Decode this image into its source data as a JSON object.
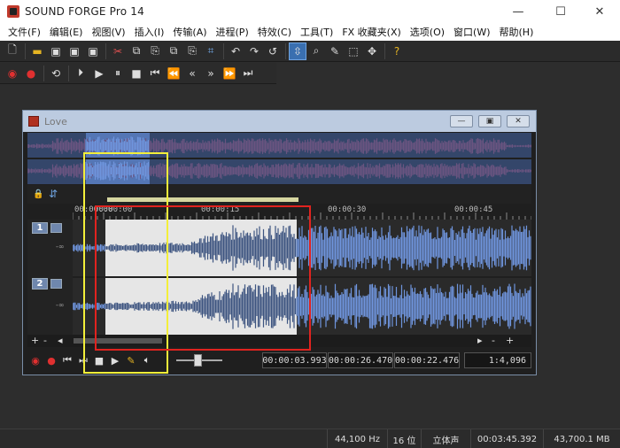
{
  "app": {
    "title": "SOUND FORGE Pro 14"
  },
  "window_controls": {
    "minimize": "—",
    "maximize": "☐",
    "close": "✕"
  },
  "menu": [
    "文件(F)",
    "编辑(E)",
    "视图(V)",
    "插入(I)",
    "传输(A)",
    "进程(P)",
    "特效(C)",
    "工具(T)",
    "FX 收藏夹(X)",
    "选项(O)",
    "窗口(W)",
    "帮助(H)"
  ],
  "data_window": {
    "title": "Love",
    "controls": {
      "minimize": "—",
      "restore": "▣",
      "close": "✕"
    },
    "ruler": [
      "00:00:00",
      "00:00:15",
      "00:00:30",
      "00:00:45"
    ],
    "channels": [
      {
        "num": "1",
        "db": "-∞"
      },
      {
        "num": "2",
        "db": "-∞"
      }
    ],
    "scroll": {
      "plus": "+",
      "minus": "-",
      "left": "◂",
      "right": "▸"
    },
    "times": {
      "selection_start": "00:00:03.993",
      "selection_end": "00:00:26.470",
      "selection_length": "00:00:22.476",
      "zoom": "1:4,096"
    }
  },
  "status": {
    "sample_rate": "44,100 Hz",
    "bit_depth": "16 位",
    "channels": "立体声",
    "length": "00:03:45.392",
    "free_space": "43,700.1 MB"
  },
  "colors": {
    "waveform": "#6f95dd",
    "waveform_dark": "#3d5480",
    "selection": "#e6e6e6",
    "yellow_box": "#f3ef3a",
    "red_box": "#e0231f"
  }
}
